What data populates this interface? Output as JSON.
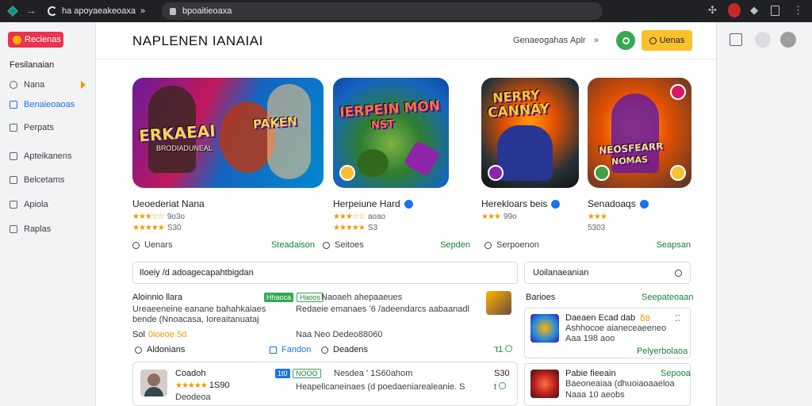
{
  "browser": {
    "tab_label": "ha apoyaeakeoaxa",
    "tab_close": "»",
    "url": "bpoaitieoaxa"
  },
  "sidebar": {
    "primary_label": "Recienas",
    "heading": "Fesilanaian",
    "items": [
      {
        "label": "Nana"
      },
      {
        "label": "Benaieoaoas"
      },
      {
        "label": "Perpats"
      },
      {
        "label": "Apteikanens"
      },
      {
        "label": "Belcetams"
      },
      {
        "label": "Apiola"
      },
      {
        "label": "Raplas"
      }
    ]
  },
  "header": {
    "title": "NAPLENEN IANAIAI",
    "link1": "Genaeogahas",
    "link2": "Aplr",
    "link2_caret": "»",
    "button_label": "Uenas"
  },
  "cards": [
    {
      "logo": "ERKAEAI",
      "logo2": "PAKEN",
      "sub": "BRODIADUNEAL",
      "name": "Ueoederiat Nana",
      "stars1": "★★★☆☆",
      "rating1": "9o3o",
      "stars2": "★★★★★",
      "rating2": "S30",
      "foot_left": "Uenars",
      "foot_right": "Steadaison"
    },
    {
      "logo": "IERPEIN MON",
      "logo2": "NST",
      "sub": "",
      "name": "Herpeiune Hard",
      "stars1": "★★★☆☆",
      "rating1": "aoao",
      "stars2": "★★★★★",
      "rating2": "S3",
      "foot_left": "Seitoes",
      "foot_right": "Sepden"
    },
    {
      "logo": "NERRY",
      "logo2": "CANNAY",
      "sub": "",
      "name": "Herekloars beis",
      "stars1": "★★★",
      "rating1": "99o",
      "stars2": "",
      "rating2": "",
      "foot_left": "Serpoenon",
      "foot_right": ""
    },
    {
      "logo": "NEOSFEARR",
      "logo2": "NOMAS",
      "sub": "",
      "name": "Senadoaqs",
      "stars1": "★★★",
      "rating1": "",
      "stars2": "",
      "rating2": "5303",
      "foot_left": "",
      "foot_right": "Seapsan"
    }
  ],
  "lower": {
    "search_value": "Iloeiy /d adoagecapahtbigdan",
    "row1_title": "Aloinnio llara",
    "row1_pill": "Hhaoca",
    "row1_pill2": "Haoos",
    "row1_meta": "Naoaeh ahepaaeues",
    "row1_line1": "Ureaeeneine eanane bahahkaiaes",
    "row1_line2": "bende (Nnoacasa, Ioreaitanuataj",
    "row1_line3": "Redaeie emanaes ʻ6 /adeendarcs aabaanadl",
    "row1_price_label": "Sol",
    "row1_price": "0ioeoe 5d",
    "row1_meta2": "Naa   Neo Dedeo88060",
    "row1_act1": "Aldonians",
    "row1_act2": "Fandon",
    "row1_act3": "Deadens",
    "row1_count": "'t1",
    "row2_name": "Coadoh",
    "row2_stars": "★★★★★",
    "row2_rating": "1S90",
    "row2_sub": "Deodeoa",
    "row2_pill": "1t0",
    "row2_pill2": "NOOO",
    "row2_meta": "Nesdea ' 1S60ahom",
    "row2_line": "Heapelicaneinaes (d poedaeniarealeanie.  S",
    "row2_price": "S30",
    "row2_count": "t",
    "side_search": "Uoilanaeanian",
    "side_heading": "Barioes",
    "side_link": "Seepateoaan",
    "side1_title": "Daeaen Ecad dab",
    "side1_sub": "Ashhocoe aianeceaeeneo",
    "side1_meta": "Aaa   198 aoo",
    "side1_badge": "ẟ8",
    "side1_link": "Pelyerbolaoa",
    "side2_title": "Pabie fieeain",
    "side2_sub": "Baeoneaiaa (dhuoiaoaaeloa",
    "side2_meta": "Naaa   10 aeobs",
    "side2_link": "Sepooa"
  },
  "colors": {
    "accent_green": "#34a853",
    "accent_yellow": "#fbc02d",
    "primary_red": "#e8344e",
    "link_blue": "#1a73e8"
  }
}
